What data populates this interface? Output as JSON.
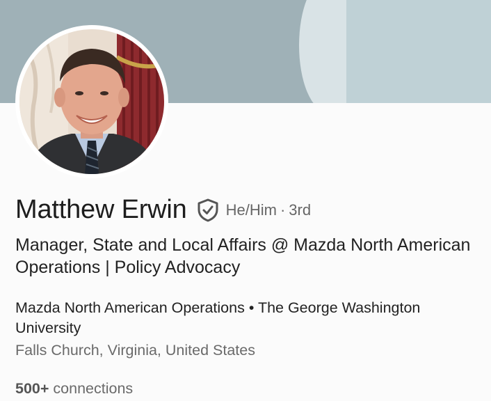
{
  "profile": {
    "name": "Matthew Erwin",
    "verified_icon": "shield-check-icon",
    "pronouns": "He/Him",
    "separator": "·",
    "degree": "3rd",
    "headline": "Manager, State and Local Affairs @ Mazda North American Operations | Policy Advocacy",
    "company": "Mazda North American Operations",
    "bullet": "•",
    "school": "The George Washington University",
    "location": "Falls Church, Virginia, United States",
    "connections_count": "500+",
    "connections_label": "connections"
  },
  "colors": {
    "cover_main": "#9fb1b7",
    "cover_arc": "#d9e3e6",
    "cover_panel": "#bfd1d6",
    "text_primary": "#1d1d1d",
    "text_secondary": "#6a6a6a"
  }
}
